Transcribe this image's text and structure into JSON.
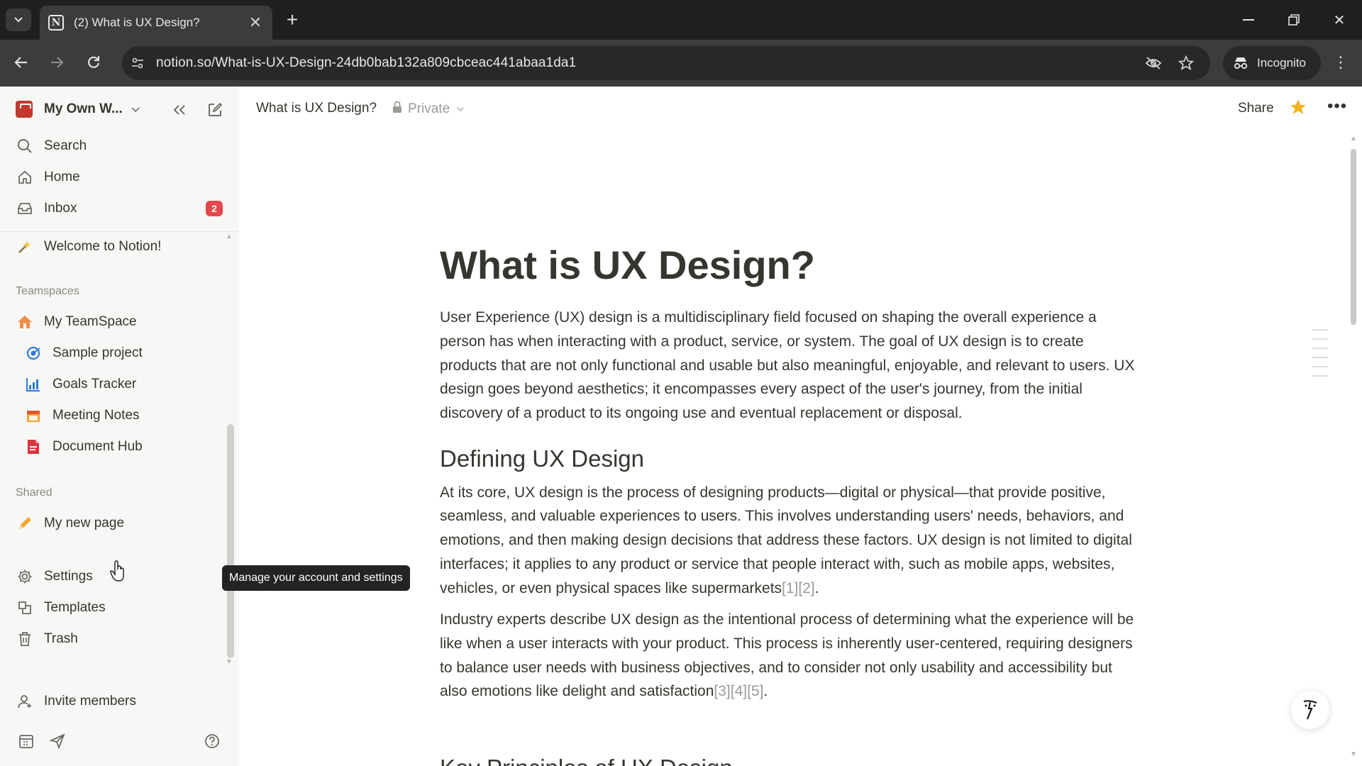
{
  "browser": {
    "tab_title": "(2) What is UX Design?",
    "favicon_letter": "N",
    "url": "notion.so/What-is-UX-Design-24db0bab132a809cbceac441abaa1da1",
    "incognito_label": "Incognito"
  },
  "sidebar": {
    "workspace_name": "My Own W...",
    "top_items": [
      {
        "label": "Search",
        "icon": "search-icon"
      },
      {
        "label": "Home",
        "icon": "home-icon"
      },
      {
        "label": "Inbox",
        "icon": "inbox-icon",
        "badge": "2"
      }
    ],
    "pinned_page": {
      "label": "Welcome to Notion!",
      "icon": "sparkle-icon"
    },
    "teamspaces_heading": "Teamspaces",
    "teamspace": {
      "label": "My TeamSpace",
      "icon": "house-icon"
    },
    "teamspace_pages": [
      {
        "label": "Sample project",
        "icon": "target-icon"
      },
      {
        "label": "Goals Tracker",
        "icon": "chart-icon"
      },
      {
        "label": "Meeting Notes",
        "icon": "calendar-icon"
      },
      {
        "label": "Document Hub",
        "icon": "document-icon"
      }
    ],
    "shared_heading": "Shared",
    "shared_pages": [
      {
        "label": "My new page",
        "icon": "pencil-icon"
      }
    ],
    "bottom_items": [
      {
        "label": "Settings",
        "icon": "gear-icon"
      },
      {
        "label": "Templates",
        "icon": "templates-icon"
      },
      {
        "label": "Trash",
        "icon": "trash-icon"
      }
    ],
    "invite_label": "Invite members"
  },
  "tooltip": "Manage your account and settings",
  "topbar": {
    "breadcrumb": "What is UX Design?",
    "privacy": "Private",
    "share_label": "Share"
  },
  "document": {
    "title": "What is UX Design?",
    "intro": "User Experience (UX) design is a multidisciplinary field focused on shaping the overall experience a person has when interacting with a product, service, or system. The goal of UX design is to create products that are not only functional and usable but also meaningful, enjoyable, and relevant to users. UX design goes beyond aesthetics; it encompasses every aspect of the user's journey, from the initial discovery of a product to its ongoing use and eventual replacement or disposal.",
    "section_heading": "Defining UX Design",
    "para1": "At its core, UX design is the process of designing products—digital or physical—that provide positive, seamless, and valuable experiences to users. This involves understanding users' needs, behaviors, and emotions, and then making design decisions that address these factors. UX design is not limited to digital interfaces; it applies to any product or service that people interact with, such as mobile apps, websites, vehicles, or even physical spaces like supermarkets",
    "para1_cite": "[1][2]",
    "para2": "Industry experts describe UX design as the intentional process of determining what the experience will be like when a user interacts with your product. This process is inherently user-centered, requiring designers to balance user needs with business objectives, and to consider not only usability and accessibility but also emotions like delight and satisfaction",
    "para2_cite": "[3][4][5]",
    "next_heading_partial": "Key Principles of UX Design"
  },
  "colors": {
    "accent_star": "#f2b31c",
    "badge_red": "#e5484d",
    "sidebar_bg": "#f7f7f5"
  }
}
